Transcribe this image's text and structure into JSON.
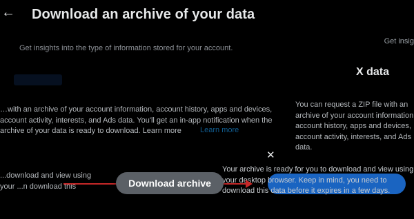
{
  "header": {
    "back_icon": "←",
    "title": "Download an archive of your data"
  },
  "subtitle": "Get insights into the type of information stored for your account.",
  "ghost_top_right": "Get insig",
  "section": {
    "title": "X data",
    "description": "…with an archive of your account information, account history, apps and devices, account activity, interests, and Ads data. You'll get an in-app notification when the archive of your data is ready to download. Learn more",
    "learn_more": "Learn more",
    "right_text": "You can request a ZIP file with an archive of your account information, account history, apps and devices, account activity, interests, and Ads data."
  },
  "modal": {
    "close_icon": "✕",
    "message": "Your archive is ready for you to download and view using your desktop browser. Keep in mind, you need to download this data before it expires in a few days.",
    "left_fragment": "...download and view using your ...n download this"
  },
  "download_button": "Download archive",
  "colors": {
    "background": "#000000",
    "accent": "#1d9bf0",
    "arrow": "#c62828",
    "button_bg": "#5b6066"
  }
}
